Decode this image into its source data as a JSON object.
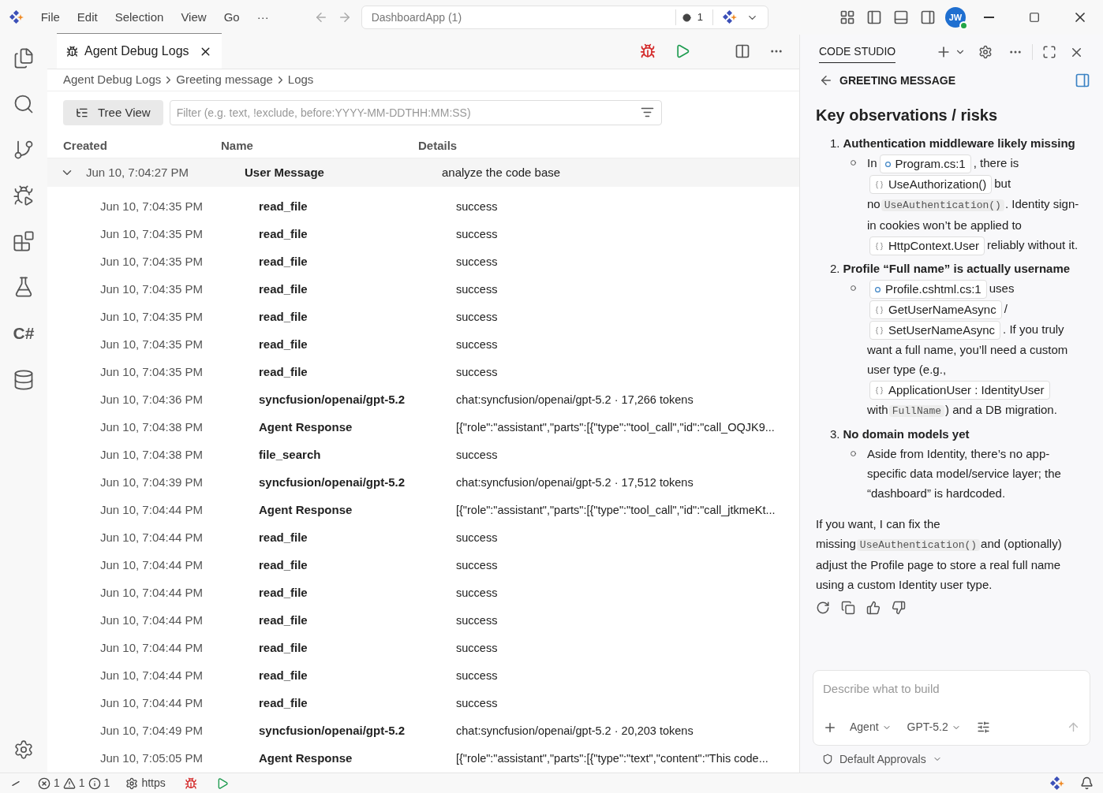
{
  "titlebar": {
    "menu": [
      "File",
      "Edit",
      "Selection",
      "View",
      "Go",
      "···"
    ],
    "search": "DashboardApp (1)",
    "changes": "1",
    "avatar": "JW"
  },
  "activity": [
    {
      "kind": "files"
    },
    {
      "kind": "search"
    },
    {
      "kind": "source-control"
    },
    {
      "kind": "run-debug"
    },
    {
      "kind": "extensions"
    },
    {
      "kind": "testing"
    },
    {
      "kind": "label",
      "label": "C#"
    },
    {
      "kind": "database"
    }
  ],
  "editor": {
    "tab": {
      "label": "Agent Debug Logs",
      "selected": true
    },
    "breadcrumb": [
      "Agent Debug Logs",
      "Greeting message",
      "Logs"
    ],
    "tree_view": "Tree View",
    "filter": {
      "placeholder": "Filter (e.g. text, !exclude, before:YYYY-MM-DDTHH:MM:SS)"
    },
    "columns": [
      "Created",
      "Name",
      "Details"
    ],
    "rows": [
      {
        "created": "Jun 10, 7:04:27 PM",
        "name": "User Message",
        "details": "analyze the code base",
        "expanded": true,
        "children": [
          {
            "created": "Jun 10, 7:04:35 PM",
            "name": "read_file",
            "details": "success"
          },
          {
            "created": "Jun 10, 7:04:35 PM",
            "name": "read_file",
            "details": "success"
          },
          {
            "created": "Jun 10, 7:04:35 PM",
            "name": "read_file",
            "details": "success"
          },
          {
            "created": "Jun 10, 7:04:35 PM",
            "name": "read_file",
            "details": "success"
          },
          {
            "created": "Jun 10, 7:04:35 PM",
            "name": "read_file",
            "details": "success"
          },
          {
            "created": "Jun 10, 7:04:35 PM",
            "name": "read_file",
            "details": "success"
          },
          {
            "created": "Jun 10, 7:04:35 PM",
            "name": "read_file",
            "details": "success"
          },
          {
            "created": "Jun 10, 7:04:36 PM",
            "name": "syncfusion/openai/gpt-5.2",
            "details": "chat:syncfusion/openai/gpt-5.2 · 17,266 tokens"
          },
          {
            "created": "Jun 10, 7:04:38 PM",
            "name": "Agent Response",
            "details": "[{\"role\":\"assistant\",\"parts\":[{\"type\":\"tool_call\",\"id\":\"call_OQJK9..."
          },
          {
            "created": "Jun 10, 7:04:38 PM",
            "name": "file_search",
            "details": "success"
          },
          {
            "created": "Jun 10, 7:04:39 PM",
            "name": "syncfusion/openai/gpt-5.2",
            "details": "chat:syncfusion/openai/gpt-5.2 · 17,512 tokens"
          },
          {
            "created": "Jun 10, 7:04:44 PM",
            "name": "Agent Response",
            "details": "[{\"role\":\"assistant\",\"parts\":[{\"type\":\"tool_call\",\"id\":\"call_jtkmeKt..."
          },
          {
            "created": "Jun 10, 7:04:44 PM",
            "name": "read_file",
            "details": "success"
          },
          {
            "created": "Jun 10, 7:04:44 PM",
            "name": "read_file",
            "details": "success"
          },
          {
            "created": "Jun 10, 7:04:44 PM",
            "name": "read_file",
            "details": "success"
          },
          {
            "created": "Jun 10, 7:04:44 PM",
            "name": "read_file",
            "details": "success"
          },
          {
            "created": "Jun 10, 7:04:44 PM",
            "name": "read_file",
            "details": "success"
          },
          {
            "created": "Jun 10, 7:04:44 PM",
            "name": "read_file",
            "details": "success"
          },
          {
            "created": "Jun 10, 7:04:44 PM",
            "name": "read_file",
            "details": "success"
          },
          {
            "created": "Jun 10, 7:04:49 PM",
            "name": "syncfusion/openai/gpt-5.2",
            "details": "chat:syncfusion/openai/gpt-5.2 · 20,203 tokens"
          },
          {
            "created": "Jun 10, 7:05:05 PM",
            "name": "Agent Response",
            "details": "[{\"role\":\"assistant\",\"parts\":[{\"type\":\"text\",\"content\":\"This code..."
          }
        ]
      }
    ]
  },
  "chat": {
    "tab": {
      "label": "CODE STUDIO",
      "selected": true
    },
    "title": "GREETING MESSAGE",
    "heading": "Key observations / risks",
    "items": [
      {
        "number": "1.",
        "title": "Authentication middleware likely missing",
        "bullets": [
          [
            {
              "kind": "text",
              "text": "In"
            },
            {
              "kind": "file",
              "text": "Program.cs:1"
            },
            {
              "kind": "text",
              "text": ", there is"
            },
            {
              "kind": "symbol",
              "text": "UseAuthorization()"
            },
            {
              "kind": "text",
              "text": "but no"
            },
            {
              "kind": "code",
              "text": "UseAuthentication()"
            },
            {
              "kind": "text",
              "text": ". Identity sign-in cookies won’t be applied to"
            },
            {
              "kind": "symbol",
              "text": "HttpContext.User"
            },
            {
              "kind": "text",
              "text": "reliably without it."
            }
          ]
        ]
      },
      {
        "number": "2.",
        "title": "Profile “Full name” is actually username",
        "bullets": [
          [
            {
              "kind": "file",
              "text": "Profile.cshtml.cs:1"
            },
            {
              "kind": "text",
              "text": "uses"
            },
            {
              "kind": "symbol",
              "text": "GetUserNameAsync"
            },
            {
              "kind": "text",
              "text": "/"
            },
            {
              "kind": "symbol",
              "text": "SetUserNameAsync"
            },
            {
              "kind": "text",
              "text": ". If you truly want a full name, you’ll need a custom user type (e.g.,"
            },
            {
              "kind": "symbol",
              "text": "ApplicationUser : IdentityUser"
            },
            {
              "kind": "text",
              "text": "with"
            },
            {
              "kind": "code",
              "text": "FullName"
            },
            {
              "kind": "text",
              "text": ") and a DB migration."
            }
          ]
        ]
      },
      {
        "number": "3.",
        "title": "No domain models yet",
        "bullets": [
          [
            {
              "kind": "text",
              "text": "Aside from Identity, there’s no app-specific data model/service layer; the “dashboard” is hardcoded."
            }
          ]
        ]
      }
    ],
    "closing": [
      {
        "kind": "text",
        "text": "If you want, I can fix the missing"
      },
      {
        "kind": "code",
        "text": "UseAuthentication()"
      },
      {
        "kind": "text",
        "text": "and (optionally) adjust the Profile page to store a real full name using a custom Identity user type."
      }
    ],
    "input": {
      "placeholder": "Describe what to build"
    },
    "mode": "Agent",
    "model": "GPT-5.2",
    "approvals": "Default Approvals"
  },
  "status": {
    "errors": "1",
    "warnings": "1",
    "infos": "1",
    "port": "https"
  }
}
